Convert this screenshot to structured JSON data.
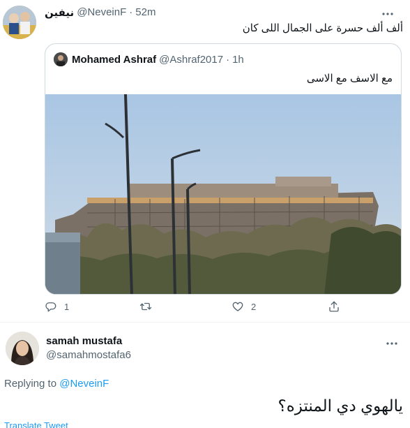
{
  "tweet1": {
    "display_name": "نيفين",
    "handle": "@NeveinF",
    "separator": "·",
    "time": "52m",
    "text": "ألف ألف حسرة على الجمال اللى كان",
    "more_icon": "more-horizontal-icon",
    "quote": {
      "display_name": "Mohamed Ashraf",
      "handle": "@Ashraf2017",
      "separator": "·",
      "time": "1h",
      "text": "مع الاسف مع الاسى"
    },
    "actions": {
      "reply_count": "1",
      "retweet_count": "",
      "like_count": "2",
      "icons": [
        "reply-icon",
        "retweet-icon",
        "like-icon",
        "share-icon"
      ]
    }
  },
  "tweet2": {
    "display_name": "samah mustafa",
    "handle": "@samahmostafa6",
    "replying_prefix": "Replying to",
    "replying_to": "@NeveinF",
    "text": "يالهوي دي المنتزه؟",
    "translate_label": "Translate Tweet",
    "more_icon": "more-horizontal-icon"
  },
  "colors": {
    "accent": "#1d9bf0",
    "muted_text": "#536471",
    "border": "#cfd9de"
  }
}
